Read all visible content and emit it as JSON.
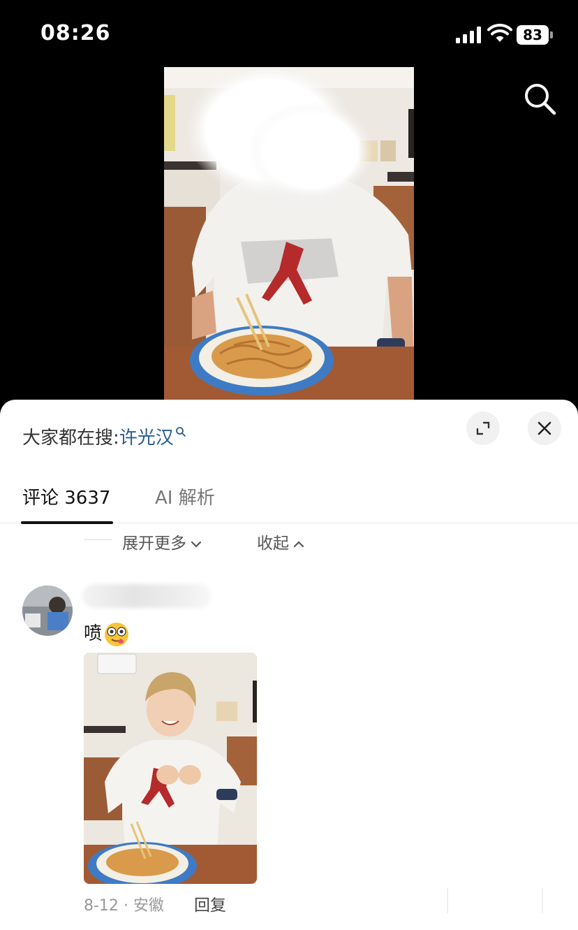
{
  "status_bar": {
    "time": "08:26",
    "battery": "83"
  },
  "search_bar": {
    "prefix": "大家都在搜:",
    "term": "许光汉"
  },
  "tabs": [
    {
      "label": "评论 3637"
    },
    {
      "label": "AI 解析"
    }
  ],
  "expand_controls": {
    "expand_more": "展开更多",
    "collapse": "收起"
  },
  "comment": {
    "text": "喷",
    "date_location": "8-12 · 安徽",
    "reply_label": "回复"
  },
  "icons": [
    "search-icon",
    "signal-icon",
    "wifi-icon",
    "battery-icon",
    "expand-icon",
    "close-icon",
    "chevron-down-icon",
    "chevron-up-icon",
    "emoji-icon"
  ],
  "colors": {
    "link_blue": "#2a5c8f",
    "sheet_bg": "#ffffff",
    "video_bg": "#000000"
  }
}
